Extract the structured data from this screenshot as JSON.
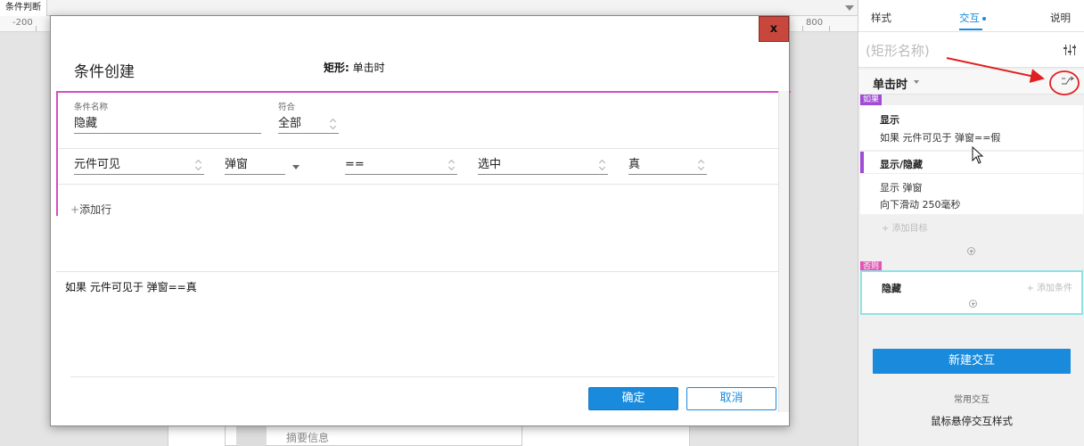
{
  "document_tab": "条件判断",
  "ruler": {
    "left_label": "-200",
    "right_label": "800"
  },
  "background": {
    "summary_label": "摘要信息"
  },
  "dialog": {
    "close_label": "x",
    "title": "条件创建",
    "subtitle_bold": "矩形:",
    "subtitle_rest": " 单击时",
    "condition_name_label": "条件名称",
    "condition_name_value": "隐藏",
    "match_label": "符合",
    "match_value": "全部",
    "rule_row": {
      "subject": "元件可见",
      "target": "弹窗",
      "operator": "==",
      "value_type": "选中",
      "value": "真"
    },
    "add_row_label": "添加行",
    "summary": "如果 元件可见于 弹窗==真",
    "ok_label": "确定",
    "cancel_label": "取消"
  },
  "right_panel": {
    "tabs": [
      "样式",
      "交互",
      "说明"
    ],
    "active_tab": "交互",
    "shape_name_placeholder": "(矩形名称)",
    "event_title": "单击时",
    "if_tag": "如果",
    "case1": {
      "title": "显示",
      "condition": "如果 元件可见于 弹窗==假"
    },
    "action_group": "显示/隐藏",
    "action_detail_1": "显示 弹窗",
    "action_detail_2": "向下滑动 250毫秒",
    "add_target": "+ 添加目标",
    "else_tag": "否则",
    "else_title": "隐藏",
    "add_condition": "+ 添加条件",
    "new_interaction": "新建交互",
    "common_interactions": "常用交互",
    "hover_style": "鼠标悬停交互样式"
  },
  "colors": {
    "accent": "#1a8bdc",
    "close_red": "#c7473c",
    "condition_border": "#d34fc4",
    "if_tag": "#a04cd4",
    "else_tag": "#e255b5",
    "else_border": "#8fe3e6",
    "annotation_red": "#e02020"
  }
}
